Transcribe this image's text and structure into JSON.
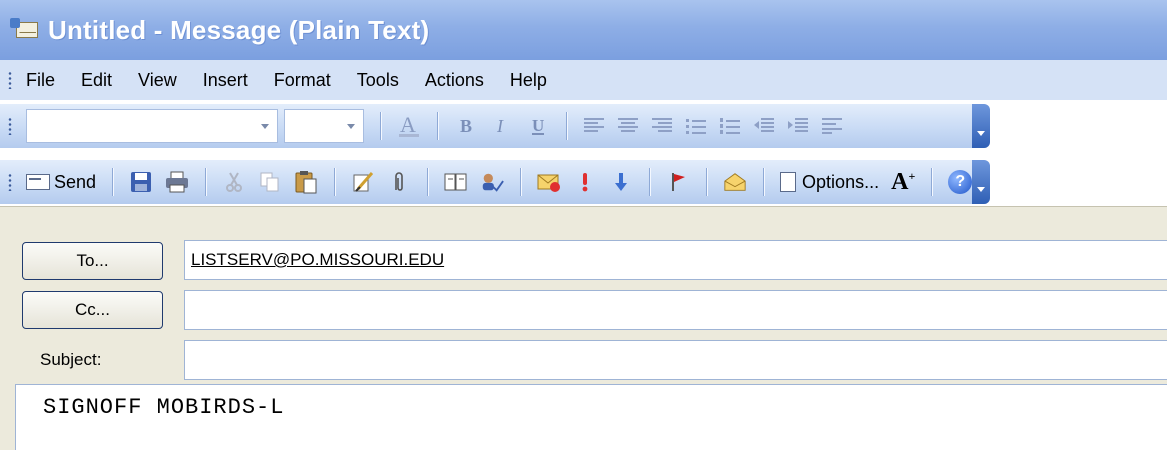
{
  "window": {
    "title": "Untitled - Message (Plain Text)"
  },
  "menu": {
    "items": [
      "File",
      "Edit",
      "View",
      "Insert",
      "Format",
      "Tools",
      "Actions",
      "Help"
    ]
  },
  "toolbar_standard": {
    "send_label": "Send",
    "options_label": "Options..."
  },
  "form": {
    "to_button": "To...",
    "cc_button": "Cc...",
    "subject_label": "Subject:",
    "to_value": "LISTSERV@PO.MISSOURI.EDU",
    "cc_value": "",
    "subject_value": ""
  },
  "message": {
    "body": "SIGNOFF MOBIRDS-L"
  }
}
